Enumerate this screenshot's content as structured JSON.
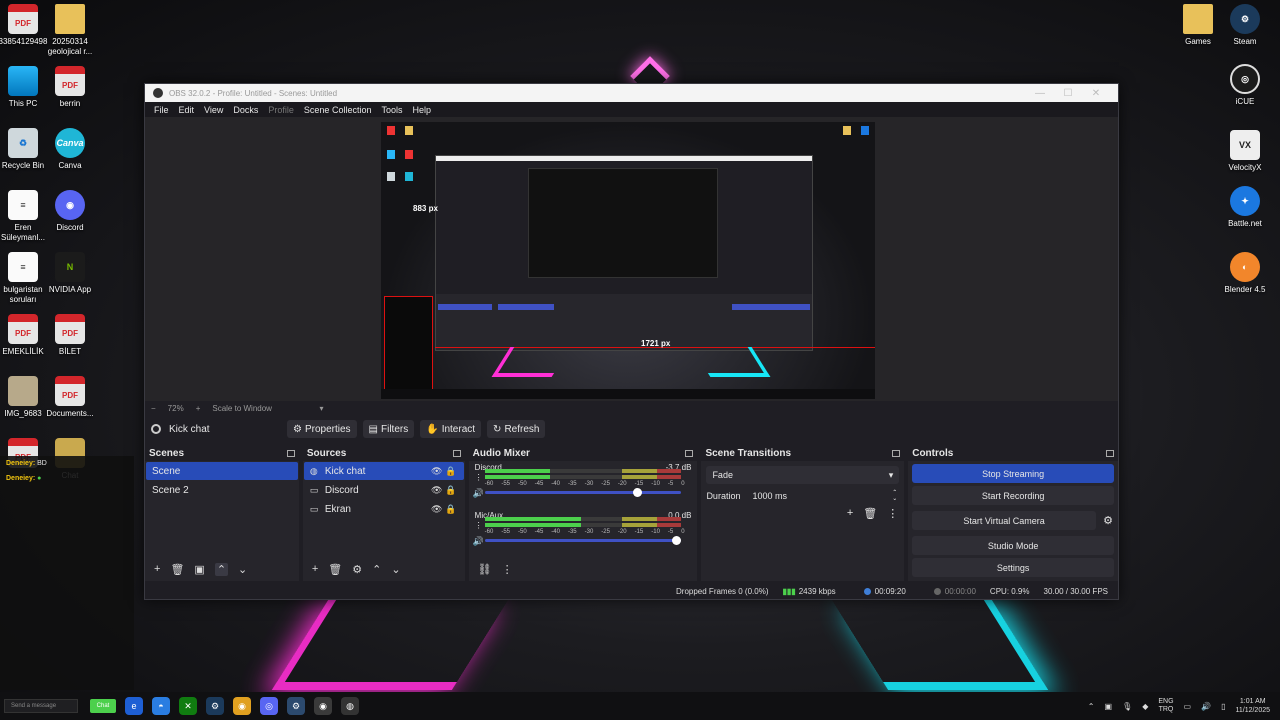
{
  "desktop": {
    "left_icons": [
      {
        "label": "33854129498",
        "kind": "pdf",
        "glyph": "PDF"
      },
      {
        "label": "20250314\ngeolojical r...",
        "kind": "folder",
        "glyph": ""
      },
      {
        "label": "This PC",
        "kind": "pc",
        "glyph": ""
      },
      {
        "label": "berrin",
        "kind": "pdf",
        "glyph": "PDF"
      },
      {
        "label": "Recycle Bin",
        "kind": "bin",
        "glyph": "♻"
      },
      {
        "label": "Canva",
        "kind": "canva",
        "glyph": "Canva"
      },
      {
        "label": "Eren\nSüleymanl...",
        "kind": "doc",
        "glyph": "≡"
      },
      {
        "label": "Discord",
        "kind": "discord",
        "glyph": "◉"
      },
      {
        "label": "bulgaristan\nsoruları",
        "kind": "doc",
        "glyph": "≡"
      },
      {
        "label": "NVIDIA App",
        "kind": "nvidia",
        "glyph": "N"
      },
      {
        "label": "EMEKLİLİK",
        "kind": "pdf",
        "glyph": "PDF"
      },
      {
        "label": "BİLET",
        "kind": "pdf",
        "glyph": "PDF"
      },
      {
        "label": "IMG_9683",
        "kind": "img",
        "glyph": ""
      },
      {
        "label": "Documents...",
        "kind": "pdf",
        "glyph": "PDF"
      },
      {
        "label": "",
        "kind": "pdf",
        "glyph": "PDF"
      },
      {
        "label": "Chat",
        "kind": "chat",
        "glyph": ""
      }
    ],
    "right_icons": [
      {
        "label": "Games",
        "kind": "folder",
        "glyph": ""
      },
      {
        "label": "Steam",
        "kind": "steam",
        "glyph": "⚙"
      },
      {
        "label": "iCUE",
        "kind": "icue",
        "glyph": "◎"
      },
      {
        "label": "VelocityX",
        "kind": "velo",
        "glyph": "VX"
      },
      {
        "label": "Battle.net",
        "kind": "battle",
        "glyph": "✦"
      },
      {
        "label": "Blender 4.5",
        "kind": "blender",
        "glyph": "◐"
      }
    ]
  },
  "chat_overlay": {
    "lines": [
      {
        "name": "Deneiey:",
        "text": "BD"
      },
      {
        "name": "Deneiey:",
        "text": "●"
      }
    ]
  },
  "obs": {
    "title": "OBS 32.0.2 - Profile: Untitled - Scenes: Untitled",
    "menu": [
      {
        "label": "File",
        "dim": false
      },
      {
        "label": "Edit",
        "dim": false
      },
      {
        "label": "View",
        "dim": false
      },
      {
        "label": "Docks",
        "dim": false
      },
      {
        "label": "Profile",
        "dim": true
      },
      {
        "label": "Scene Collection",
        "dim": false
      },
      {
        "label": "Tools",
        "dim": false
      },
      {
        "label": "Help",
        "dim": false
      }
    ],
    "preview": {
      "height_label": "883 px",
      "width_label": "1721 px"
    },
    "zoom": {
      "minus": "−",
      "percent": "72%",
      "plus": "+",
      "mode": "Scale to Window",
      "arrow": "▾"
    },
    "context": {
      "source_name": "Kick chat",
      "buttons": [
        {
          "icon": "⚙",
          "label": "Properties",
          "icon_name": "gear-icon"
        },
        {
          "icon": "▤",
          "label": "Filters",
          "icon_name": "filter-icon"
        },
        {
          "icon": "✋",
          "label": "Interact",
          "icon_name": "hand-icon"
        },
        {
          "icon": "↻",
          "label": "Refresh",
          "icon_name": "refresh-icon"
        }
      ]
    },
    "scenes": {
      "title": "Scenes",
      "items": [
        {
          "label": "Scene",
          "active": true
        },
        {
          "label": "Scene 2",
          "active": false
        }
      ]
    },
    "sources": {
      "title": "Sources",
      "items": [
        {
          "label": "Kick chat",
          "icon": "◍",
          "active": true
        },
        {
          "label": "Discord",
          "icon": "▭",
          "active": false
        },
        {
          "label": "Ekran",
          "icon": "▭",
          "active": false
        }
      ]
    },
    "mixer": {
      "title": "Audio Mixer",
      "channels": [
        {
          "name": "Discord",
          "db": "-3.7 dB",
          "level": 0.48,
          "volume": 0.78
        },
        {
          "name": "Mic/Aux",
          "db": "0.0 dB",
          "level": 0.7,
          "volume": 0.98
        }
      ],
      "ticks": [
        "-60",
        "-55",
        "-50",
        "-45",
        "-40",
        "-35",
        "-30",
        "-25",
        "-20",
        "-15",
        "-10",
        "-5",
        "0"
      ]
    },
    "transitions": {
      "title": "Scene Transitions",
      "selected": "Fade",
      "duration_label": "Duration",
      "duration_value": "1000 ms"
    },
    "controls": {
      "title": "Controls",
      "stop_streaming": "Stop Streaming",
      "start_recording": "Start Recording",
      "start_virtual_camera": "Start Virtual Camera",
      "studio_mode": "Studio Mode",
      "settings": "Settings"
    },
    "status": {
      "dropped_frames": "Dropped Frames 0 (0.0%)",
      "bitrate": "2439 kbps",
      "stream_time": "00:09:20",
      "rec_time": "00:00:00",
      "cpu": "CPU: 0.9%",
      "fps": "30.00 / 30.00 FPS"
    }
  },
  "taskbar": {
    "message_placeholder": "Send a message",
    "chat_button": "Chat",
    "language_top": "ENG",
    "language_bottom": "TRQ",
    "time": "1:01 AM",
    "date": "11/12/2025"
  },
  "colors": {
    "accent": "#284cb8",
    "panel": "#26252b",
    "neon_pink": "#ff2fd6",
    "neon_cyan": "#17e6f6"
  }
}
